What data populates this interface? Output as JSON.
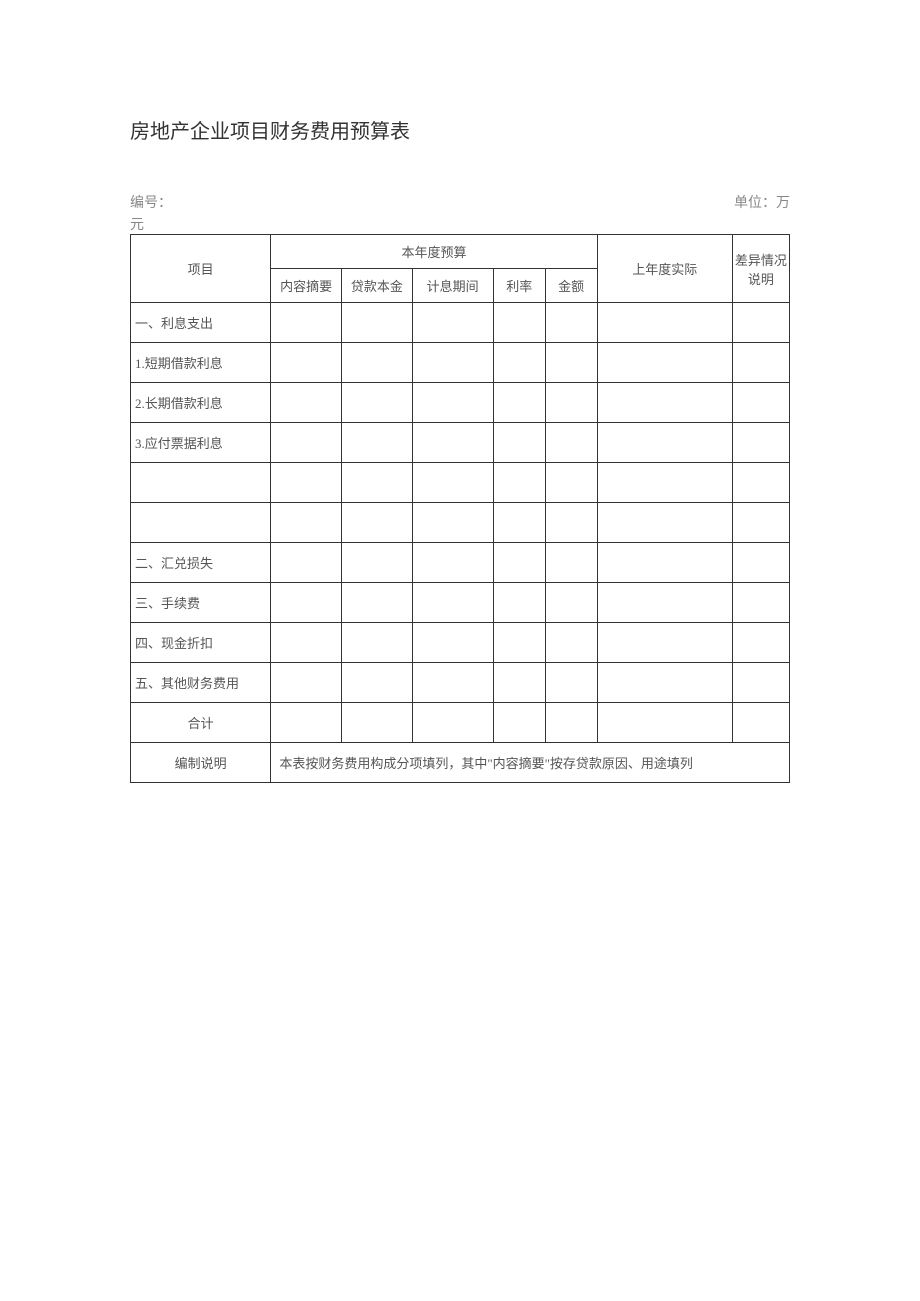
{
  "title": "房地产企业项目财务费用预算表",
  "meta": {
    "id_label": "编号：",
    "unit_label": "单位：万元"
  },
  "headers": {
    "project": "项目",
    "this_year_budget": "本年度预算",
    "summary": "内容摘要",
    "principal": "贷款本金",
    "period": "计息期间",
    "rate": "利率",
    "amount": "金额",
    "last_year_actual": "上年度实际",
    "diff_desc": "差异情况说明"
  },
  "rows": [
    {
      "label": "一、利息支出",
      "align": "left"
    },
    {
      "label": "1.短期借款利息",
      "align": "left"
    },
    {
      "label": "2.长期借款利息",
      "align": "left"
    },
    {
      "label": "3.应付票据利息",
      "align": "left"
    },
    {
      "label": "",
      "align": "left"
    },
    {
      "label": "",
      "align": "left"
    },
    {
      "label": "二、汇兑损失",
      "align": "left"
    },
    {
      "label": "三、手续费",
      "align": "left"
    },
    {
      "label": "四、现金折扣",
      "align": "left"
    },
    {
      "label": "五、其他财务费用",
      "align": "left"
    },
    {
      "label": "合计",
      "align": "center"
    }
  ],
  "footer": {
    "label": "编制说明",
    "text": "本表按财务费用构成分项填列，其中\"内容摘要\"按存贷款原因、用途填列"
  }
}
